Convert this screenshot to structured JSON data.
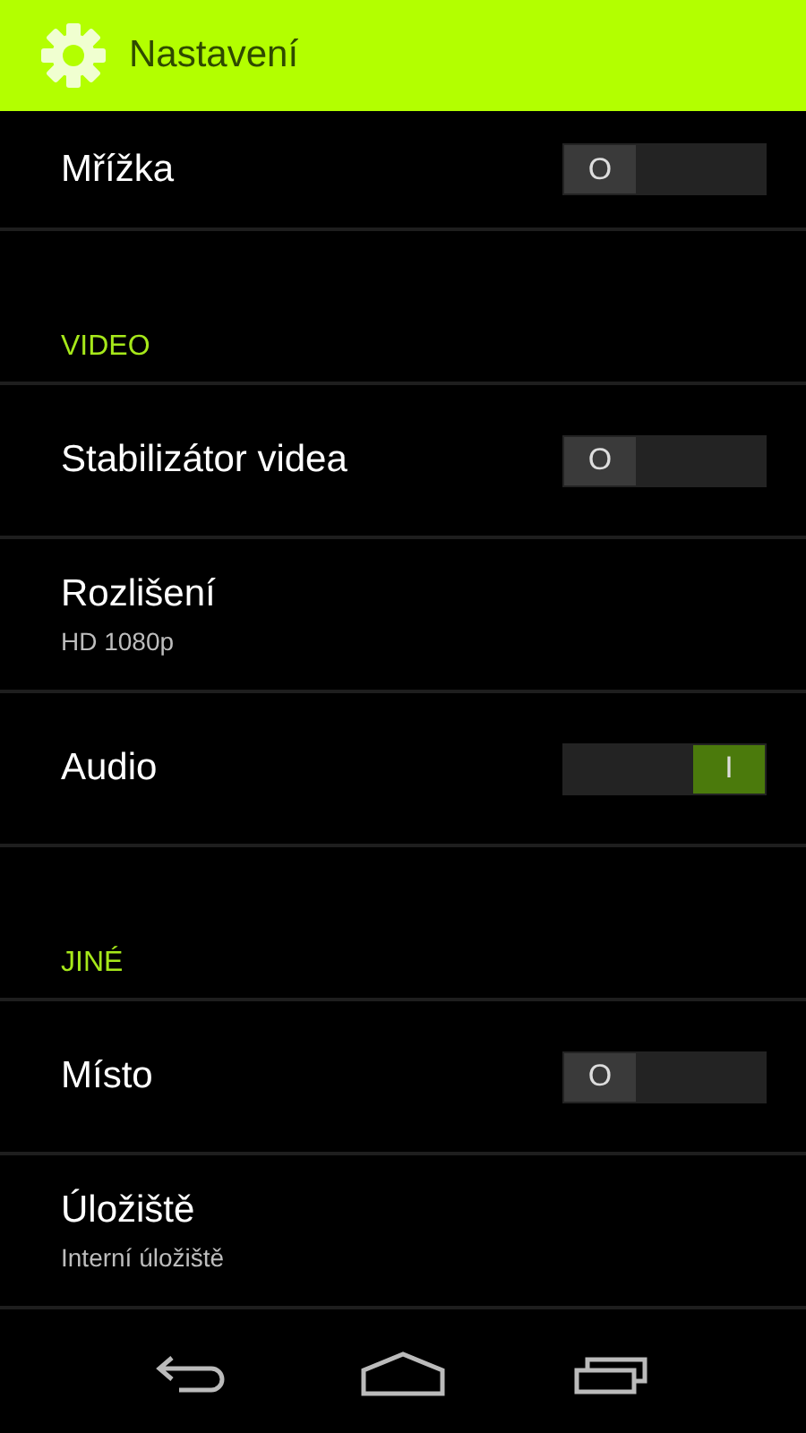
{
  "action_bar": {
    "title": "Nastavení"
  },
  "sections": [
    {
      "items": [
        {
          "kind": "toggle",
          "label": "Mřížka",
          "on": false,
          "switch_text": "O"
        }
      ]
    },
    {
      "header": "VIDEO",
      "items": [
        {
          "kind": "toggle",
          "label": "Stabilizátor videa",
          "on": false,
          "switch_text": "O"
        },
        {
          "kind": "value",
          "label": "Rozlišení",
          "value": "HD 1080p"
        },
        {
          "kind": "toggle",
          "label": "Audio",
          "on": true,
          "switch_text": "I"
        }
      ]
    },
    {
      "header": "JINÉ",
      "items": [
        {
          "kind": "toggle",
          "label": "Místo",
          "on": false,
          "switch_text": "O"
        },
        {
          "kind": "value",
          "label": "Úložiště",
          "value": "Interní úložiště"
        }
      ]
    }
  ]
}
